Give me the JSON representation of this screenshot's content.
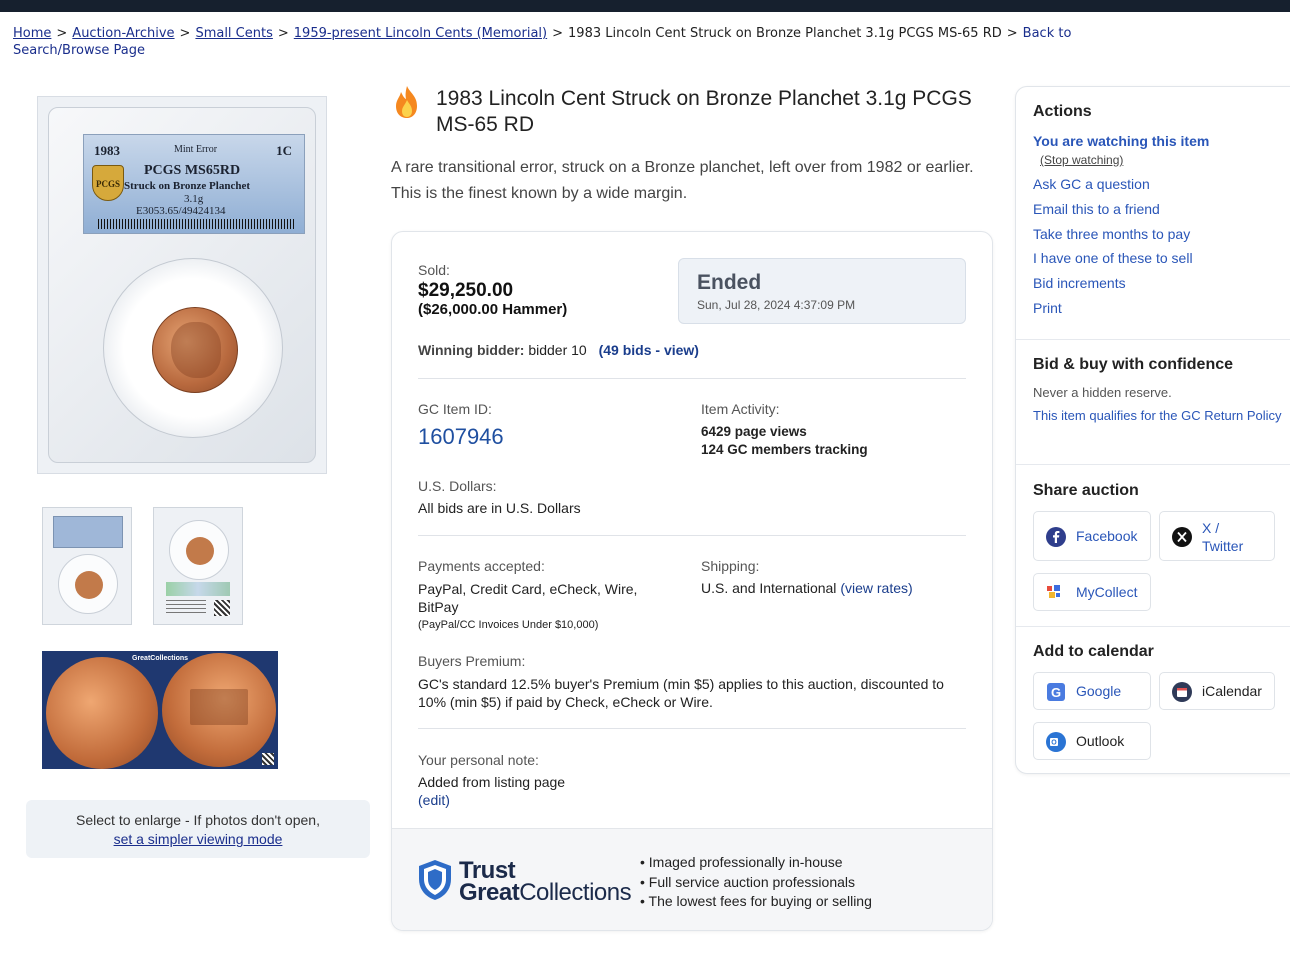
{
  "breadcrumb": {
    "home": "Home",
    "auction_archive": "Auction-Archive",
    "small_cents": "Small Cents",
    "lincoln_memorial": "1959-present Lincoln Cents (Memorial)",
    "current": "1983 Lincoln Cent Struck on Bronze Planchet 3.1g PCGS MS-65 RD",
    "back_to": "Back to",
    "back_to_2": "Search/Browse Page",
    "separator": ">"
  },
  "slab": {
    "year": "1983",
    "variety": "Mint Error",
    "denomination": "1C",
    "grade": "PCGS MS65RD",
    "description": "Struck on Bronze Planchet",
    "weight": "3.1g",
    "cert": "E3053.65/49424134",
    "logo": "PCGS"
  },
  "gallery": {
    "promo_brand": "GreatCollections",
    "enlarge_text": "Select to enlarge - If photos don't open,",
    "enlarge_link": "set a simpler viewing mode"
  },
  "listing": {
    "icon": "fire-icon",
    "title": "1983 Lincoln Cent Struck on Bronze Planchet 3.1g PCGS MS-65 RD",
    "subtitle": "A rare transitional error, struck on a Bronze planchet, left over from 1982 or earlier. This is the finest known by a wide margin."
  },
  "sale": {
    "sold_label": "Sold:",
    "sold_price": "$29,250.00",
    "hammer": "($26,000.00 Hammer)",
    "status": "Ended",
    "ended_date": "Sun, Jul 28, 2024 4:37:09 PM",
    "winning_label": "Winning bidder:",
    "winning_value": "bidder 10",
    "bids_link": "(49 bids - view)"
  },
  "details": {
    "item_id_label": "GC Item ID:",
    "item_id": "1607946",
    "activity_label": "Item Activity:",
    "page_views": "6429 page views",
    "members_tracking": "124 GC members tracking",
    "currency_label": "U.S. Dollars:",
    "currency_value": "All bids are in U.S. Dollars",
    "payments_label": "Payments accepted:",
    "payments_value": "PayPal, Credit Card, eCheck, Wire, BitPay",
    "payments_note": "(PayPal/CC Invoices Under $10,000)",
    "shipping_label": "Shipping:",
    "shipping_value": "U.S. and International",
    "shipping_link": "(view rates)",
    "premium_label": "Buyers Premium:",
    "premium_value": "GC's standard 12.5% buyer's Premium (min $5) applies to this auction, discounted to 10% (min $5) if paid by Check, eCheck or Wire.",
    "note_label": "Your personal note:",
    "note_value": "Added from listing page",
    "note_edit": "(edit)"
  },
  "trust": {
    "word1": "Trust",
    "word2a": "Great",
    "word2b": "Collections",
    "points": [
      "• Imaged professionally in-house",
      "• Full service auction professionals",
      "• The lowest fees for buying or selling"
    ]
  },
  "sidebar": {
    "actions_title": "Actions",
    "watching": "You are watching this item",
    "stop_watching": "(Stop watching)",
    "actions": [
      "Ask GC a question",
      "Email this to a friend",
      "Take three months to pay",
      "I have one of these to sell",
      "Bid increments",
      "Print"
    ],
    "confidence_title": "Bid & buy with confidence",
    "no_reserve": "Never a hidden reserve.",
    "return_policy": "This item qualifies for the GC Return Policy",
    "share_title": "Share auction",
    "facebook": "Facebook",
    "x_twitter_1": "X /",
    "x_twitter_2": "Twitter",
    "mycollect": "MyCollect",
    "calendar_title": "Add to calendar",
    "google": "Google",
    "icalendar": "iCalendar",
    "outlook": "Outlook"
  },
  "colors": {
    "link": "#1a2e8c",
    "accent_blue": "#2a56b8",
    "topbar": "#16202e"
  }
}
